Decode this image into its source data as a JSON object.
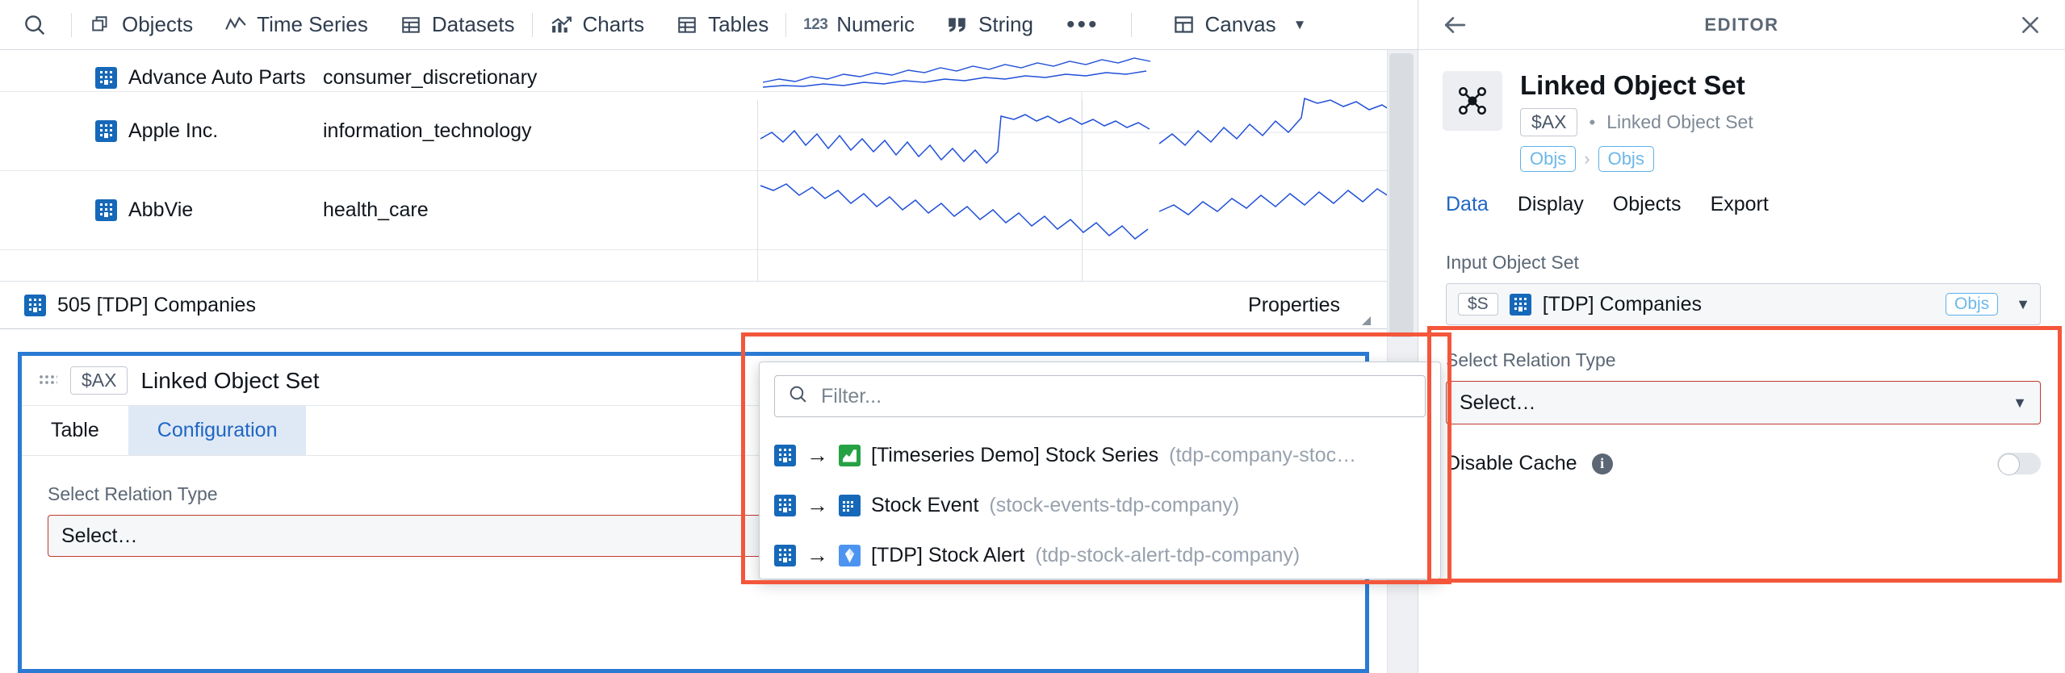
{
  "toolbar": {
    "search_icon": "search-icon",
    "items": [
      {
        "label": "Objects",
        "icon": "objects-icon"
      },
      {
        "label": "Time Series",
        "icon": "time-series-icon"
      },
      {
        "label": "Datasets",
        "icon": "datasets-icon"
      },
      {
        "label": "Charts",
        "icon": "charts-icon"
      },
      {
        "label": "Tables",
        "icon": "tables-icon"
      },
      {
        "label": "Numeric",
        "icon": "123-icon"
      },
      {
        "label": "String",
        "icon": "quote-icon"
      }
    ],
    "overflow_label": "•••",
    "canvas_label": "Canvas",
    "canvas_caret": "▼"
  },
  "table": {
    "rows": [
      {
        "name": "Advance Auto Parts",
        "sector": "consumer_discretionary"
      },
      {
        "name": "Apple Inc.",
        "sector": "information_technology"
      },
      {
        "name": "AbbVie",
        "sector": "health_care"
      }
    ],
    "status_count": "505 [TDP] Companies",
    "properties_label": "Properties"
  },
  "linked_object_card": {
    "badge": "$AX",
    "title": "Linked Object Set",
    "tabs": [
      {
        "label": "Table",
        "active": false
      },
      {
        "label": "Configuration",
        "active": true
      }
    ],
    "relation_label": "Select Relation Type",
    "relation_value": "Select…",
    "caret": "▼"
  },
  "dropdown": {
    "filter_placeholder": "Filter...",
    "filter_value": "",
    "search_icon": "search-icon",
    "arrow": "→",
    "options": [
      {
        "source_icon": "building-icon",
        "target_icon": "timeseries-icon",
        "label": "[Timeseries Demo] Stock Series",
        "id": "(tdp-company-stoc…"
      },
      {
        "source_icon": "building-icon",
        "target_icon": "calendar-icon",
        "label": "Stock Event",
        "id": "(stock-events-tdp-company)"
      },
      {
        "source_icon": "building-icon",
        "target_icon": "alert-icon",
        "label": "[TDP] Stock Alert",
        "id": "(tdp-stock-alert-tdp-company)"
      }
    ]
  },
  "editor": {
    "header_title": "EDITOR",
    "back_icon": "arrow-left-icon",
    "close_icon": "close-icon",
    "object_icon": "linked-object-set-icon",
    "object_name": "Linked Object Set",
    "badge": "$AX",
    "separator": "•",
    "object_type": "Linked Object Set",
    "breadcrumbs": [
      "Objs",
      "Objs"
    ],
    "breadcrumb_sep": "›",
    "tabs": [
      {
        "label": "Data",
        "active": true
      },
      {
        "label": "Display",
        "active": false
      },
      {
        "label": "Objects",
        "active": false
      },
      {
        "label": "Export",
        "active": false
      }
    ],
    "input_object_set_label": "Input Object Set",
    "input_object_set_badge": "$S",
    "input_object_set_value": "[TDP] Companies",
    "input_object_set_pill": "Objs",
    "relation_label": "Select Relation Type",
    "relation_value": "Select…",
    "caret": "▼",
    "disable_cache_label": "Disable Cache",
    "disable_cache_info": "i",
    "disable_cache_on": false
  },
  "colors": {
    "accent_blue": "#1f66c4",
    "selection_blue": "#2a7ad4",
    "annotation_red": "#f4563b",
    "error_red": "#c0392f",
    "object_blue": "#1668b8",
    "link_blue": "#6cb7ea"
  }
}
